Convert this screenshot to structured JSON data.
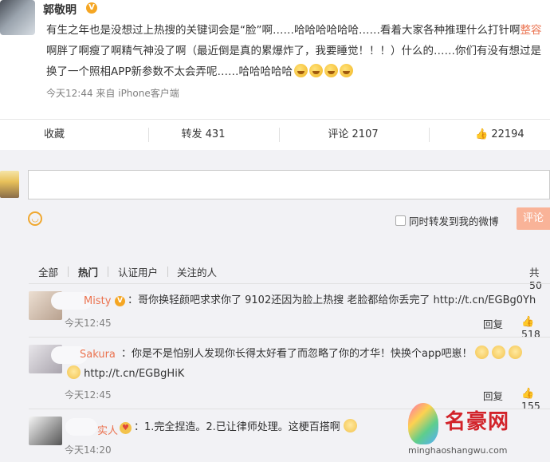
{
  "post": {
    "author": "郭敬明",
    "verified_mark": "V",
    "text_before": "有生之年也是没想过上热搜的关键词会是“脸”啊……哈哈哈哈哈哈……看着大家各种推理什么打针啊",
    "text_highlight": "整容",
    "text_after": "啊胖了啊瘦了啊精气神没了啊（最近倒是真的累爆炸了，我要睡觉！！！）什么的……你们有没有想过是换了一个照相APP新参数不太会弄呢……哈哈哈哈哈",
    "timestamp": "今天12:44",
    "source": "来自 iPhone客户端"
  },
  "actions": {
    "favorite": "收藏",
    "repost": "转发 431",
    "comment": "评论 2107",
    "likes": "22194"
  },
  "comment_box": {
    "emoji_icon": "smile-face-icon",
    "repost_checkbox_label": "同时转发到我的微博",
    "submit_label": "评论"
  },
  "filters": {
    "all": "全部",
    "hot": "热门",
    "verified": "认证用户",
    "following": "关注的人",
    "total": "共50"
  },
  "comments": [
    {
      "name": "Misty",
      "text": "：哥你换轻颜吧求求你了 9102还因为脸上热搜 老脸都给你丢完了 http://t.cn/EGBg0Yh",
      "time": "今天12:45",
      "reply": "回复",
      "likes": "518"
    },
    {
      "name": "Sakura",
      "text": "：你是不是怕别人发现你长得太好看了而忽略了你的才华！快换个app吧崽！",
      "link": "http://t.cn/EGBgHiK",
      "time": "今天12:45",
      "reply": "回复",
      "likes": "155"
    },
    {
      "name": "实人",
      "text": "：1.完全捏造。2.已让律师处理。这梗百搭啊",
      "time": "今天14:20"
    }
  ],
  "watermark": {
    "name": "名豪网",
    "url": "minghaoshangwu.com"
  },
  "colors": {
    "accent": "#eb7350",
    "verified": "#f5a623",
    "button": "#f9b398"
  }
}
